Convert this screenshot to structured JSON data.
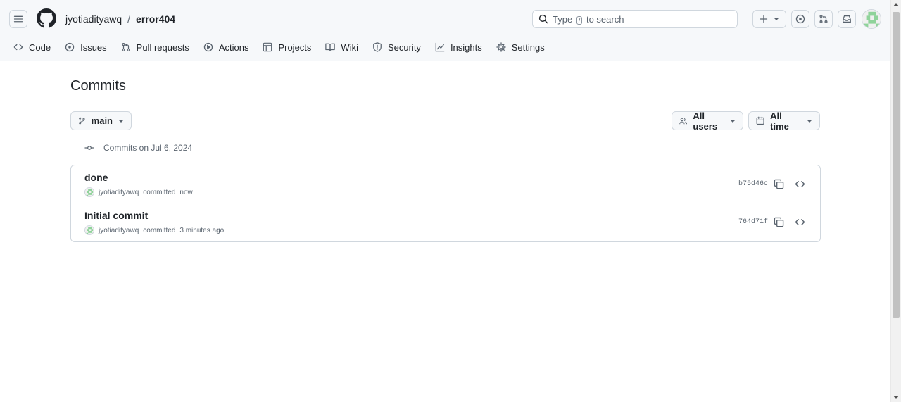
{
  "header": {
    "owner": "jyotiadityawq",
    "separator": "/",
    "repo": "error404",
    "search_prefix": "Type",
    "search_key": "/",
    "search_suffix": "to search"
  },
  "nav": {
    "items": [
      {
        "label": "Code",
        "icon": "code-icon"
      },
      {
        "label": "Issues",
        "icon": "issue-icon"
      },
      {
        "label": "Pull requests",
        "icon": "pull-request-icon"
      },
      {
        "label": "Actions",
        "icon": "play-icon"
      },
      {
        "label": "Projects",
        "icon": "table-icon"
      },
      {
        "label": "Wiki",
        "icon": "book-icon"
      },
      {
        "label": "Security",
        "icon": "shield-icon"
      },
      {
        "label": "Insights",
        "icon": "graph-icon"
      },
      {
        "label": "Settings",
        "icon": "gear-icon"
      }
    ]
  },
  "main": {
    "title": "Commits",
    "branch": "main",
    "users_filter": "All users",
    "time_filter": "All time",
    "group_label": "Commits on Jul 6, 2024",
    "commits": [
      {
        "title": "done",
        "author": "jyotiadityawq",
        "verb": "committed",
        "time": "now",
        "sha": "b75d46c"
      },
      {
        "title": "Initial commit",
        "author": "jyotiadityawq",
        "verb": "committed",
        "time": "3 minutes ago",
        "sha": "764d71f"
      }
    ]
  },
  "colors": {
    "border": "#d0d7de",
    "muted": "#59636e",
    "text": "#1f2328",
    "avatar_green": "#8fd39a"
  }
}
